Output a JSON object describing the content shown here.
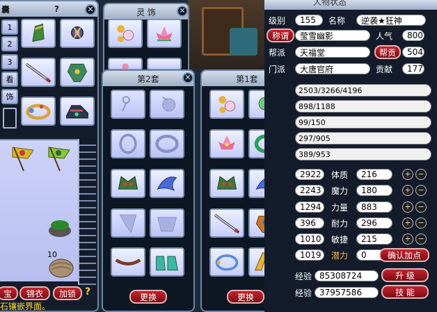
{
  "inventory": {
    "title_fragment": "囊",
    "help": "?",
    "tabs": [
      "1",
      "2",
      "3",
      "看",
      "饰"
    ],
    "bottom_buttons": [
      "宝",
      "锦衣",
      "加锁"
    ],
    "hint_question": "?",
    "status_text": "石镶嵌界面。",
    "stack_count": "10"
  },
  "accessory_window": {
    "title": "灵 饰"
  },
  "set2_window": {
    "title": "第2套",
    "swap_label": "更换"
  },
  "set1_window": {
    "title": "第1套",
    "swap_label": "更换"
  },
  "character": {
    "header_title": "人物状态",
    "level_label": "级别",
    "level": "155",
    "name_label": "名称",
    "name": "逆袭★狂神",
    "title_button": "称谓",
    "title_value": "莹雪幽影",
    "popularity_label": "人气",
    "popularity": "800",
    "guild_label": "帮派",
    "guild": "天福堂",
    "guild_contrib_button": "帮贡",
    "guild_contrib": "504",
    "school_label": "门派",
    "school": "大唐官府",
    "contrib_label": "贡献",
    "contrib": "177",
    "bars": [
      "2503/3266/4196",
      "898/1188",
      "99/150",
      "297/905",
      "389/953"
    ],
    "stats": [
      {
        "left": "2922",
        "label": "体质",
        "value": "216"
      },
      {
        "left": "2243",
        "label": "魔力",
        "value": "180"
      },
      {
        "left": "1294",
        "label": "力量",
        "value": "883"
      },
      {
        "left": "396",
        "label": "耐力",
        "value": "296"
      },
      {
        "left": "1010",
        "label": "敏捷",
        "value": "215"
      }
    ],
    "potential_left": "1019",
    "potential_label": "潜力",
    "potential_value": "0",
    "confirm_button": "确认加点",
    "exp1_label": "经验",
    "exp1": "85308724",
    "exp2_label": "经验",
    "exp2": "37957586",
    "upgrade_button": "升 级",
    "skills_button": "技 能"
  }
}
